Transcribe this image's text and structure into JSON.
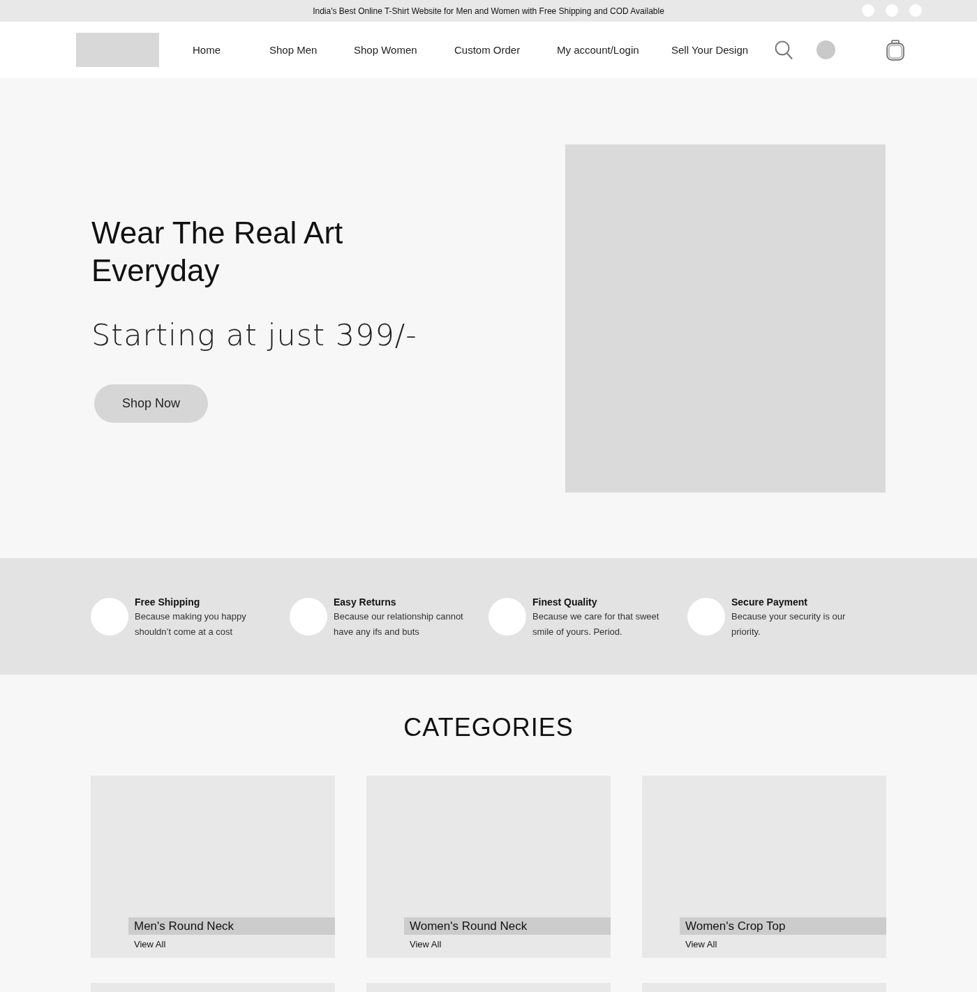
{
  "top_bar": {
    "text": "India's Best Online T-Shirt Website for Men and Women with Free Shipping and COD Available",
    "social_links": [
      {
        "kind": "circle"
      },
      {
        "kind": "circle"
      },
      {
        "kind": "circle"
      }
    ]
  },
  "nav": {
    "items": [
      {
        "label": "Home"
      },
      {
        "label": "Shop Men"
      },
      {
        "label": "Shop Women"
      },
      {
        "label": "Custom Order"
      },
      {
        "label": "My account/Login"
      },
      {
        "label": "Sell Your Design"
      }
    ]
  },
  "hero": {
    "title": "Wear The Real Art Everyday",
    "subtitle": "Starting at just 399/-",
    "button": "Shop Now"
  },
  "features": [
    {
      "title": "Free Shipping",
      "text": "Because making you happy shouldn’t come at a cost"
    },
    {
      "title": "Easy Returns",
      "text": "Because our relationship cannot have any ifs and buts"
    },
    {
      "title": "Finest Quality",
      "text": "Because we care for that sweet smile of yours. Period."
    },
    {
      "title": "Secure Payment",
      "text": "Because your security is our priority."
    }
  ],
  "categories": {
    "heading": "CATEGORIES",
    "cards": [
      {
        "name": "Men's Round Neck",
        "link": "View All"
      },
      {
        "name": "Women's Round Neck",
        "link": "View All"
      },
      {
        "name": "Women's Crop Top",
        "link": "View All"
      }
    ],
    "next_row": [
      {
        "kind": "card"
      },
      {
        "kind": "card"
      },
      {
        "kind": "card"
      }
    ]
  }
}
